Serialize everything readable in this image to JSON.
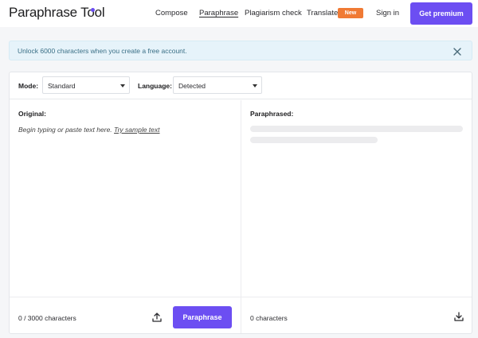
{
  "header": {
    "logo": "Paraphrase Tool",
    "nav": {
      "compose": "Compose",
      "paraphrase": "Paraphrase",
      "plagiarism": "Plagiarism check",
      "translate": "Translate",
      "new_badge": "New",
      "sign_in": "Sign in"
    },
    "premium_button": "Get premium"
  },
  "banner": {
    "text": "Unlock 6000 characters when you create a free account."
  },
  "toolbar": {
    "mode_label": "Mode:",
    "mode_value": "Standard",
    "language_label": "Language:",
    "language_value": "Detected"
  },
  "original": {
    "title": "Original:",
    "placeholder": "Begin typing or paste text here.",
    "sample_link": "Try sample text",
    "char_count": "0 / 3000 characters",
    "paraphrase_button": "Paraphrase"
  },
  "paraphrased": {
    "title": "Paraphrased:",
    "char_count": "0 characters"
  },
  "colors": {
    "accent": "#6c4ef2",
    "badge": "#f07a34",
    "banner_bg": "#e6f3fa"
  },
  "icons": {
    "banner_close": "close-icon",
    "upload": "upload-icon",
    "download": "download-icon"
  }
}
